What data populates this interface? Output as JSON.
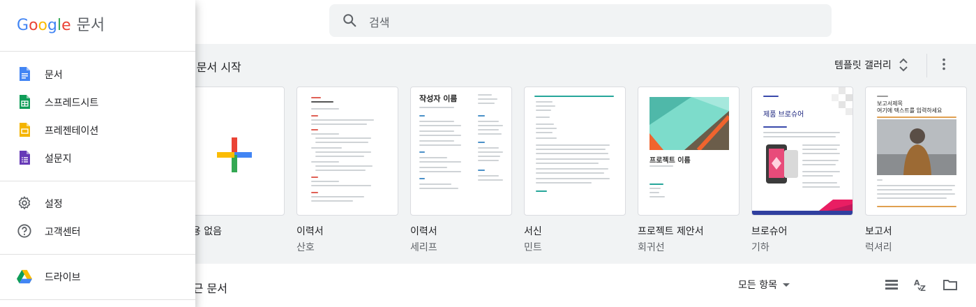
{
  "search": {
    "placeholder": "검색"
  },
  "templates_section": {
    "title": "새 문서 시작",
    "gallery_label": "템플릿 갤러리",
    "items": [
      {
        "name": "내용 없음",
        "sub": ""
      },
      {
        "name": "이력서",
        "sub": "산호"
      },
      {
        "name": "이력서",
        "sub": "세리프"
      },
      {
        "name": "서신",
        "sub": "민트"
      },
      {
        "name": "프로젝트 제안서",
        "sub": "회귀선"
      },
      {
        "name": "브로슈어",
        "sub": "기하"
      },
      {
        "name": "보고서",
        "sub": "럭셔리"
      }
    ],
    "thumbs": {
      "serif_name": "작성자 이름",
      "proposal_title": "프로젝트 이름",
      "brochure_title": "제품 브로슈어",
      "report_title": "보고서제목",
      "report_subtitle": "여기에 텍스트를 입력하세요"
    }
  },
  "recent_section": {
    "title": "최근 문서",
    "filter_label": "모든 항목"
  },
  "drawer": {
    "brand_google": [
      "G",
      "o",
      "o",
      "g",
      "l",
      "e"
    ],
    "brand_app": "문서",
    "items": [
      {
        "label": "문서"
      },
      {
        "label": "스프레드시트"
      },
      {
        "label": "프레젠테이션"
      },
      {
        "label": "설문지"
      },
      {
        "label": "설정"
      },
      {
        "label": "고객센터"
      },
      {
        "label": "드라이브"
      }
    ]
  },
  "colors": {
    "google_blue": "#4285f4",
    "google_red": "#ea4335",
    "google_yellow": "#fbbc04",
    "google_green": "#34a853",
    "forms_purple": "#673ab7"
  }
}
